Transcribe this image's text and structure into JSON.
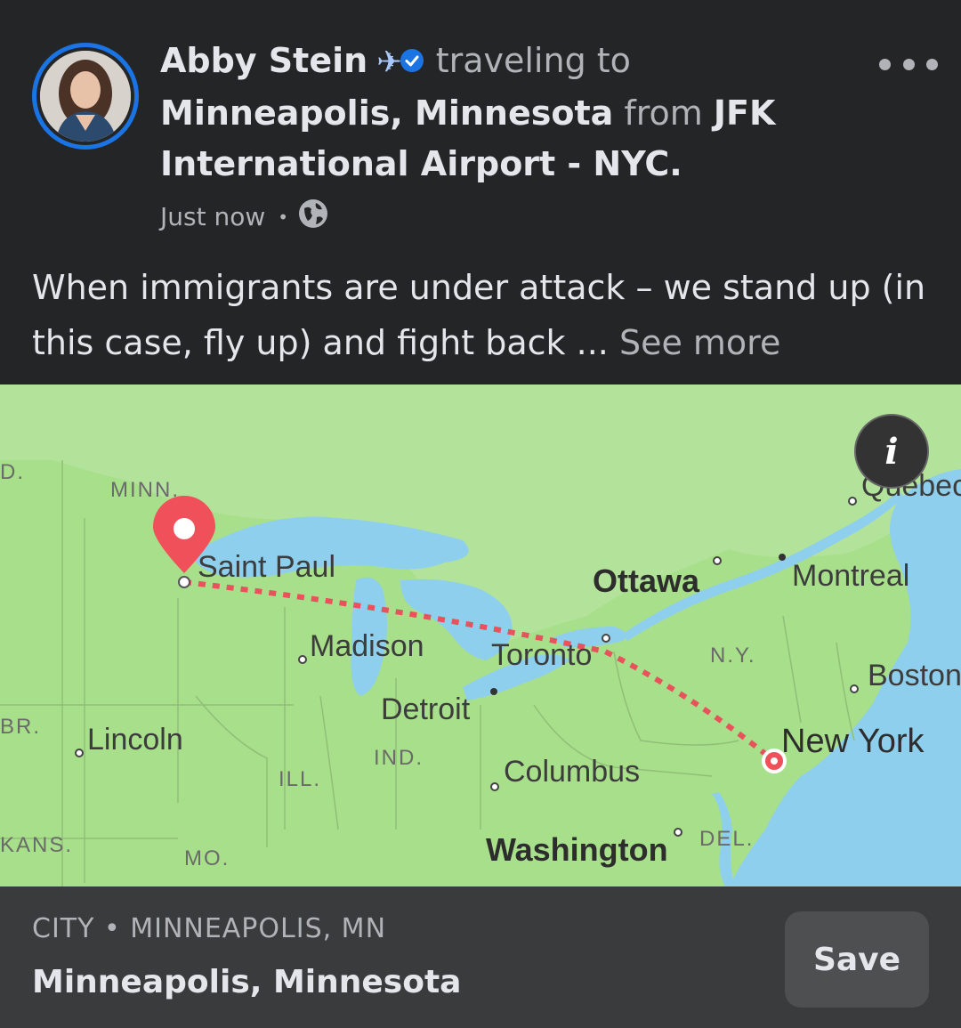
{
  "post": {
    "author": "Abby Stein",
    "status_verb": "traveling to",
    "destination": "Minneapolis, Minnesota",
    "from_word": "from",
    "origin": "JFK International Airport - NYC.",
    "timestamp": "Just now",
    "body": "When immigrants are under attack – we stand up (in this case, fly up) and fight back ...",
    "see_more_label": "See more"
  },
  "map": {
    "labels": {
      "saint_paul": "Saint Paul",
      "ottawa": "Ottawa",
      "montreal": "Montreal",
      "quebec": "Quebec",
      "madison": "Madison",
      "toronto": "Toronto",
      "ny_state": "N.Y.",
      "boston": "Boston",
      "detroit": "Detroit",
      "lincoln": "Lincoln",
      "new_york": "New York",
      "ind": "IND.",
      "columbus": "Columbus",
      "ill": "ILL.",
      "washington": "Washington",
      "del": "DEL.",
      "kans": "KANS.",
      "mo": "MO.",
      "minn": "MINN.",
      "nd": "D.",
      "nebr": "BR."
    },
    "info_label": "i"
  },
  "footer": {
    "category": "CITY • MINNEAPOLIS, MN",
    "place": "Minneapolis, Minnesota",
    "save_label": "Save"
  },
  "colors": {
    "background": "#242526",
    "verified_blue": "#1b74e4",
    "pin_red": "#f0505a",
    "water": "#8fcfee",
    "land": "#a8df8a"
  }
}
